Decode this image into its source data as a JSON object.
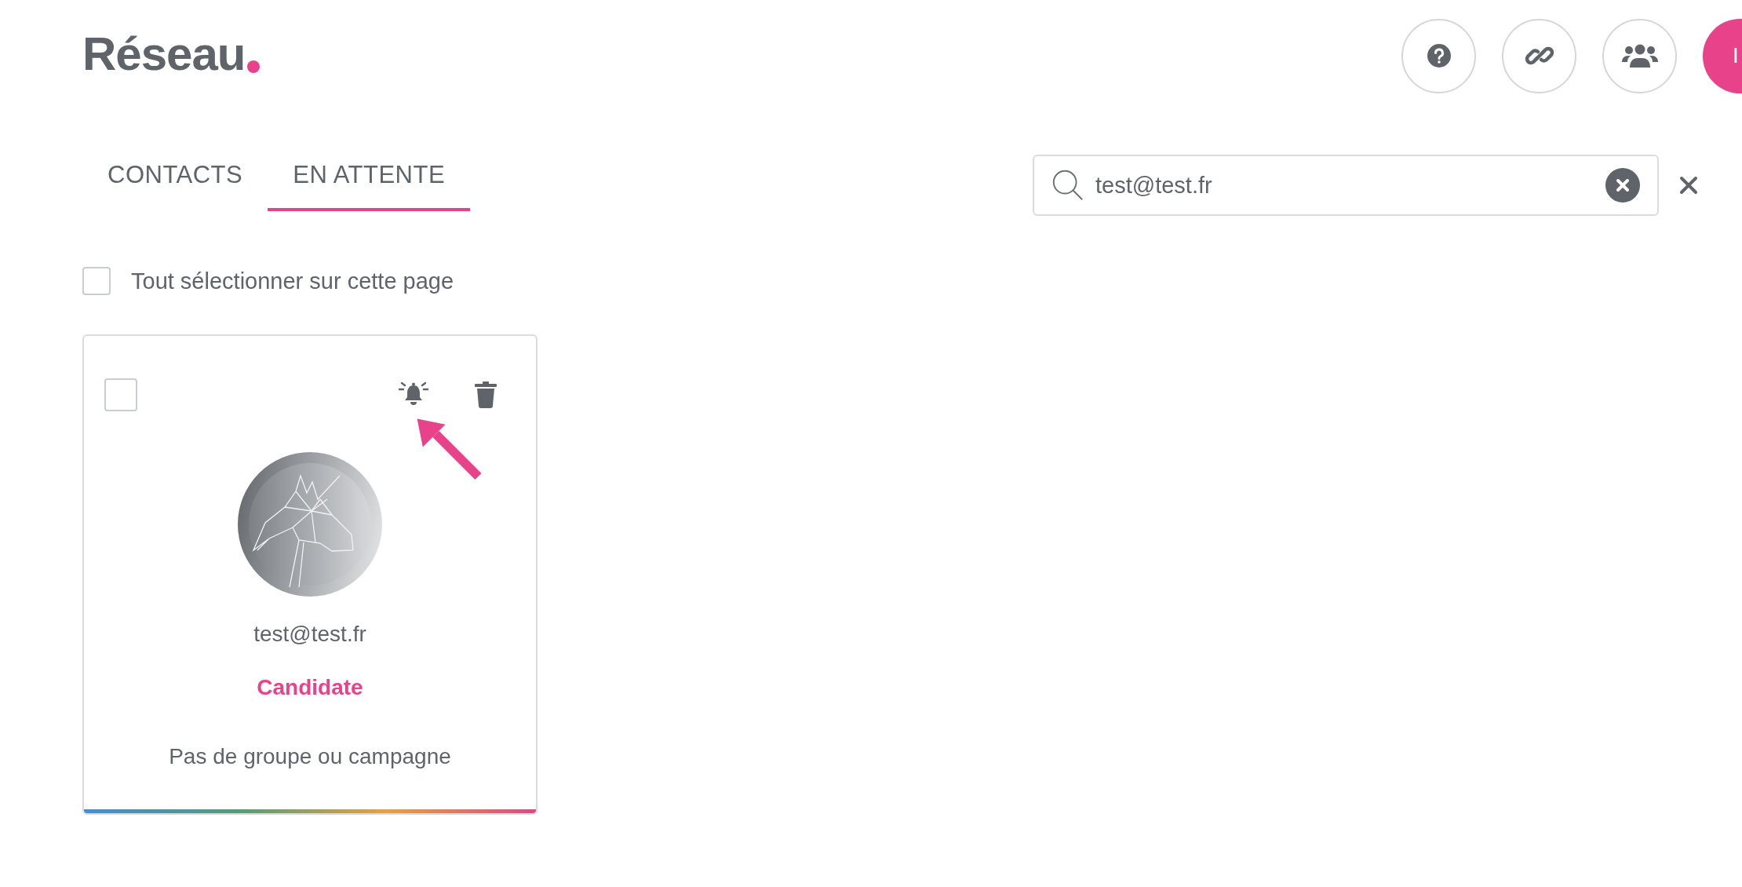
{
  "logo": {
    "text": "Réseau"
  },
  "header": {
    "cta_label": "I"
  },
  "tabs": [
    {
      "label": "CONTACTS",
      "selected": false
    },
    {
      "label": "EN ATTENTE",
      "selected": true
    }
  ],
  "search": {
    "value": "test@test.fr"
  },
  "select_all": {
    "label": "Tout sélectionner sur cette page",
    "checked": false
  },
  "cards": [
    {
      "checked": false,
      "email": "test@test.fr",
      "role": "Candidate",
      "groups": "Pas de groupe ou campagne"
    }
  ]
}
